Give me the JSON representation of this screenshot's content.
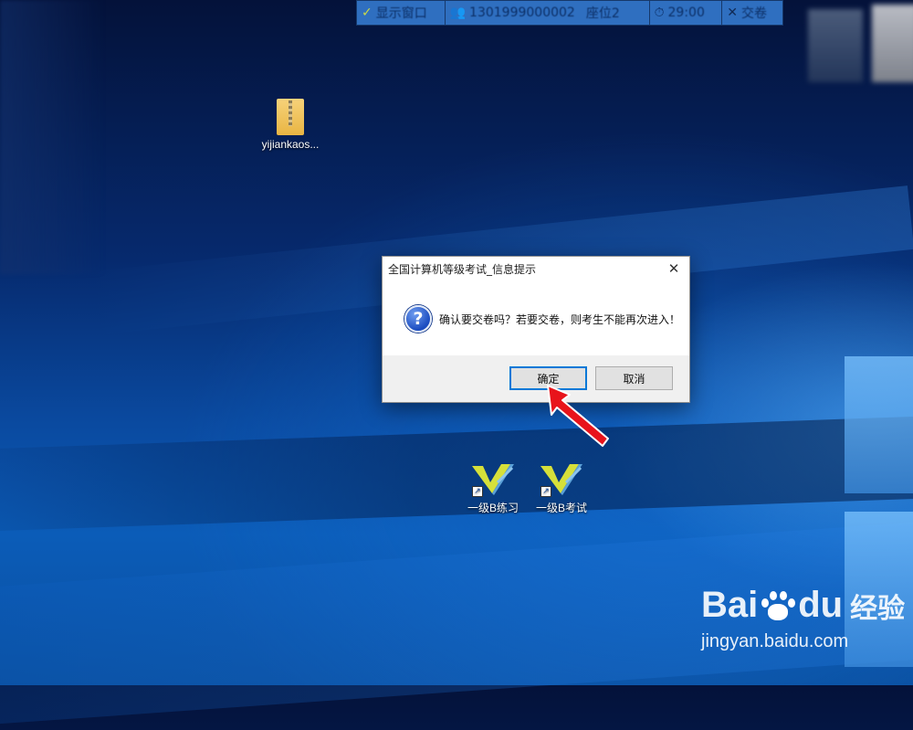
{
  "toolbar": {
    "show_window_label": "显示窗口",
    "candidate_number": "1301999000002",
    "seat_label": "座位2",
    "timer": "29:00",
    "submit_label": "交卷"
  },
  "desktop": {
    "icons": [
      {
        "label": "yijiankaos..."
      },
      {
        "label": "一级B练习"
      },
      {
        "label": "一级B考试"
      }
    ]
  },
  "dialog": {
    "title": "全国计算机等级考试_信息提示",
    "message": "确认要交卷吗？若要交卷，则考生不能再次进入！",
    "confirm_label": "确定",
    "cancel_label": "取消",
    "close_glyph": "✕"
  },
  "watermark": {
    "brand": "Bai",
    "brand_suffix": "du",
    "cn": "经验",
    "url": "jingyan.baidu.com"
  },
  "colors": {
    "accent": "#0078d7",
    "annotation_arrow": "#e8141b",
    "toolbar_bg": "#2f6fc0"
  }
}
